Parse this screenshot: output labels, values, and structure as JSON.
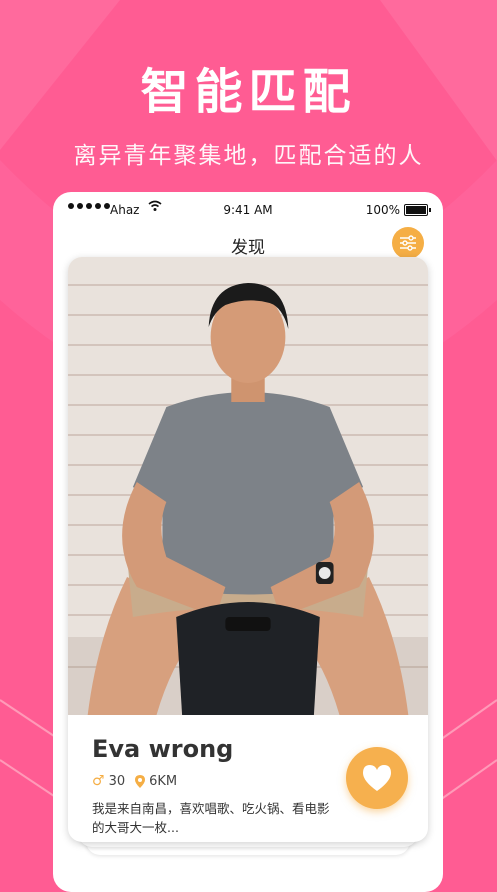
{
  "promo": {
    "headline": "智能匹配",
    "subline": "离异青年聚集地，匹配合适的人"
  },
  "status_bar": {
    "carrier": "Ahaz",
    "time": "9:41 AM",
    "battery": "100%"
  },
  "nav": {
    "title": "发现",
    "filter_icon": "filter-sliders-icon"
  },
  "profile_card": {
    "name": "Eva wrong",
    "age": "30",
    "gender_icon": "male-icon",
    "distance": "6KM",
    "location_icon": "location-pin-icon",
    "bio": "我是来自南昌，喜欢唱歌、吃火锅、看电影的大哥大一枚...",
    "like_icon": "heart-icon"
  },
  "colors": {
    "background": "#ff5c93",
    "accent": "#f5ae45"
  }
}
